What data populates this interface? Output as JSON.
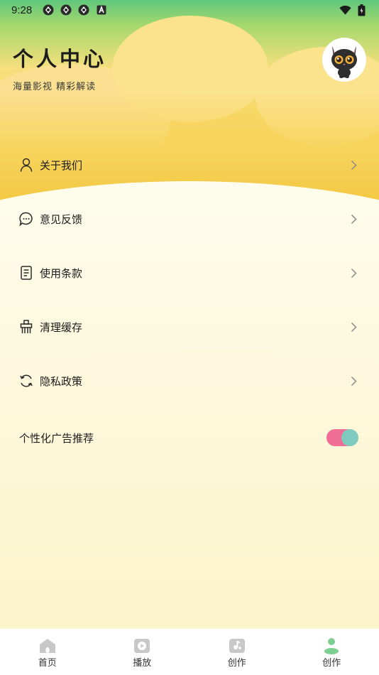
{
  "status_bar": {
    "time": "9:28",
    "icons": [
      "app-notification-icon",
      "app-notification-icon",
      "app-notification-icon",
      "a-icon"
    ],
    "right_icons": [
      "wifi-icon",
      "battery-icon"
    ]
  },
  "header": {
    "title": "个人中心",
    "subtitle": "海量影视 精彩解读"
  },
  "avatar": {
    "icon": "black-cat-avatar"
  },
  "menu": {
    "items": [
      {
        "label": "关于我们",
        "icon": "user-icon"
      },
      {
        "label": "意见反馈",
        "icon": "chat-bubble-icon"
      },
      {
        "label": "使用条款",
        "icon": "document-icon"
      },
      {
        "label": "清理缓存",
        "icon": "broom-icon"
      },
      {
        "label": "隐私政策",
        "icon": "refresh-icon"
      }
    ]
  },
  "personalized_ads": {
    "label": "个性化广告推荐",
    "enabled": true
  },
  "tabbar": {
    "tabs": [
      {
        "label": "首页",
        "icon": "home-icon",
        "active": false
      },
      {
        "label": "播放",
        "icon": "play-icon",
        "active": false
      },
      {
        "label": "创作",
        "icon": "create-icon",
        "active": false
      },
      {
        "label": "创作",
        "icon": "profile-icon",
        "active": true
      }
    ]
  },
  "colors": {
    "toggle_track": "#ef6e96",
    "toggle_knob": "#7fcbc0",
    "header_green": "#5fc77c",
    "header_yellow": "#f7d35a",
    "active_tab": "#7dcf92",
    "inactive_tab": "#c8c8c8"
  }
}
